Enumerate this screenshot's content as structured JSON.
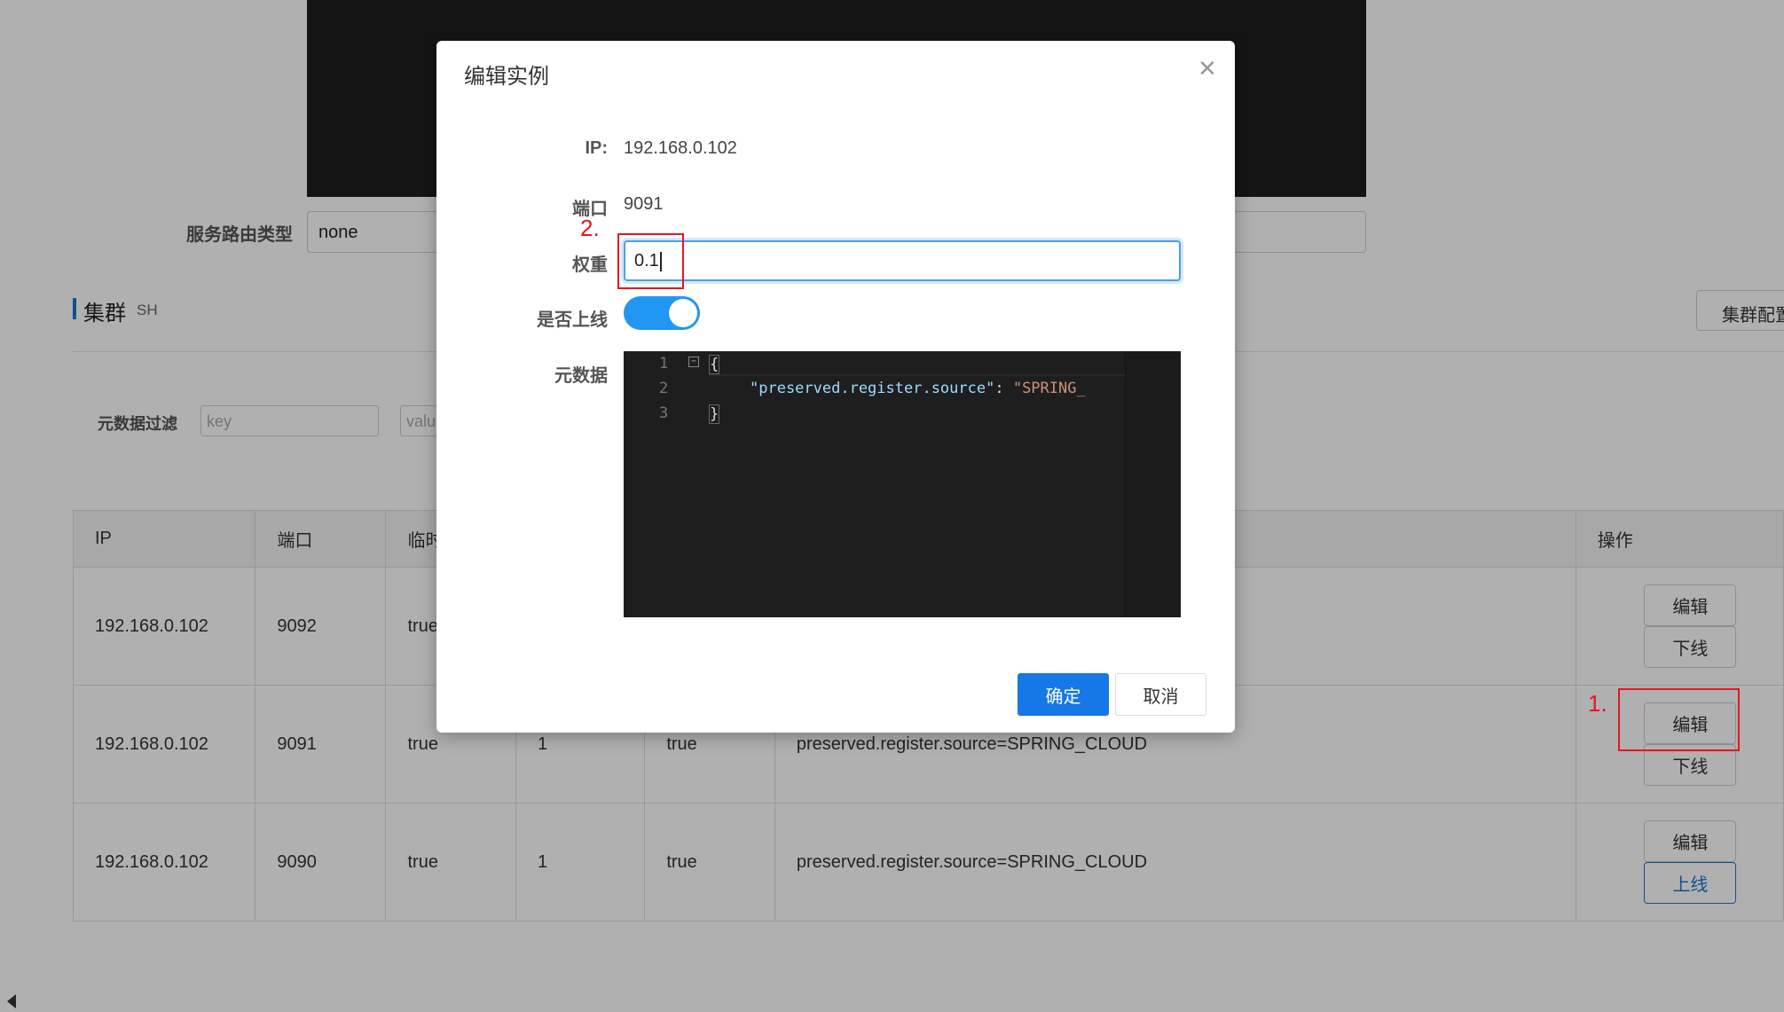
{
  "page": {
    "route_type_label": "服务路由类型",
    "route_type_value": "none",
    "cluster_title": "集群",
    "cluster_name": "SH",
    "cluster_config_button": "集群配置",
    "metadata_filter_label": "元数据过滤",
    "filter_key_placeholder": "key",
    "filter_value_placeholder": "value"
  },
  "table": {
    "headers": [
      "IP",
      "端口",
      "临时实例",
      "",
      "",
      "",
      "操作"
    ],
    "rows": [
      {
        "ip": "192.168.0.102",
        "port": "9092",
        "ephemeral": "true",
        "weight": "",
        "healthy": "",
        "metadata": "",
        "actions": [
          "编辑",
          "下线"
        ]
      },
      {
        "ip": "192.168.0.102",
        "port": "9091",
        "ephemeral": "true",
        "weight": "1",
        "healthy": "true",
        "metadata": "preserved.register.source=SPRING_CLOUD",
        "actions": [
          "编辑",
          "下线"
        ]
      },
      {
        "ip": "192.168.0.102",
        "port": "9090",
        "ephemeral": "true",
        "weight": "1",
        "healthy": "true",
        "metadata": "preserved.register.source=SPRING_CLOUD",
        "actions": [
          "编辑",
          "上线"
        ]
      }
    ]
  },
  "dialog": {
    "title": "编辑实例",
    "ip_label": "IP:",
    "ip_value": "192.168.0.102",
    "port_label": "端口",
    "port_value": "9091",
    "weight_label": "权重",
    "weight_value": "0.1",
    "online_label": "是否上线",
    "online": true,
    "metadata_label": "元数据",
    "editor_lines": [
      "1",
      "2",
      "3"
    ],
    "editor_open": "{",
    "editor_key": "\"preserved.register.source\"",
    "editor_colon": ": ",
    "editor_value": "\"SPRING_",
    "editor_close": "}",
    "ok_button": "确定",
    "cancel_button": "取消"
  },
  "annotations": {
    "step1": "1.",
    "step2": "2."
  },
  "colors": {
    "primary": "#1677e6",
    "annotation": "#e8151f",
    "toggle": "#2196f3"
  }
}
